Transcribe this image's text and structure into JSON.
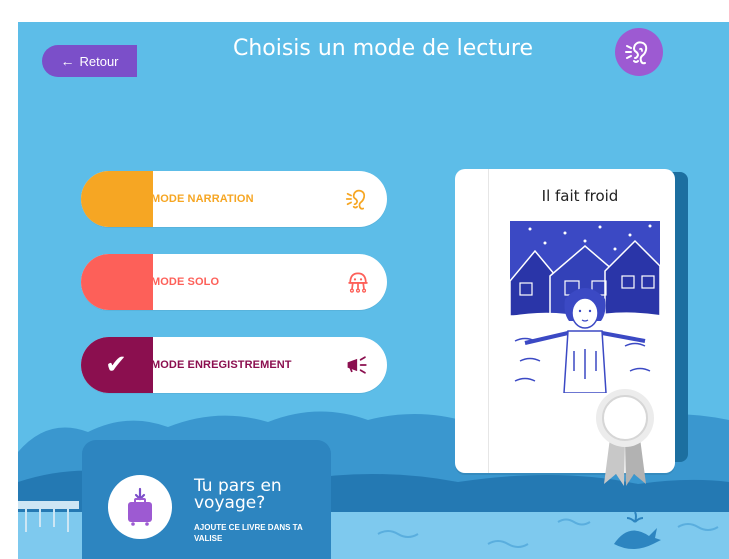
{
  "header": {
    "back_label": "Retour",
    "title": "Choisis un mode de lecture"
  },
  "modes": [
    {
      "label": "MODE NARRATION",
      "color": "#f6a623",
      "icon": "ear-icon",
      "selected": false
    },
    {
      "label": "MODE SOLO",
      "color": "#fd6059",
      "icon": "robot-icon",
      "selected": false
    },
    {
      "label": "MODE ENREGISTREMENT",
      "color": "#8b0f4f",
      "icon": "megaphone-icon",
      "selected": true
    }
  ],
  "book": {
    "title": "Il fait froid"
  },
  "travel": {
    "headline": "Tu pars en voyage?",
    "cta": "AJOUTE CE LIVRE DANS TA VALISE"
  },
  "colors": {
    "background": "#5dbde8",
    "purple": "#7b4fc9",
    "dark_blue": "#2d85c0"
  }
}
